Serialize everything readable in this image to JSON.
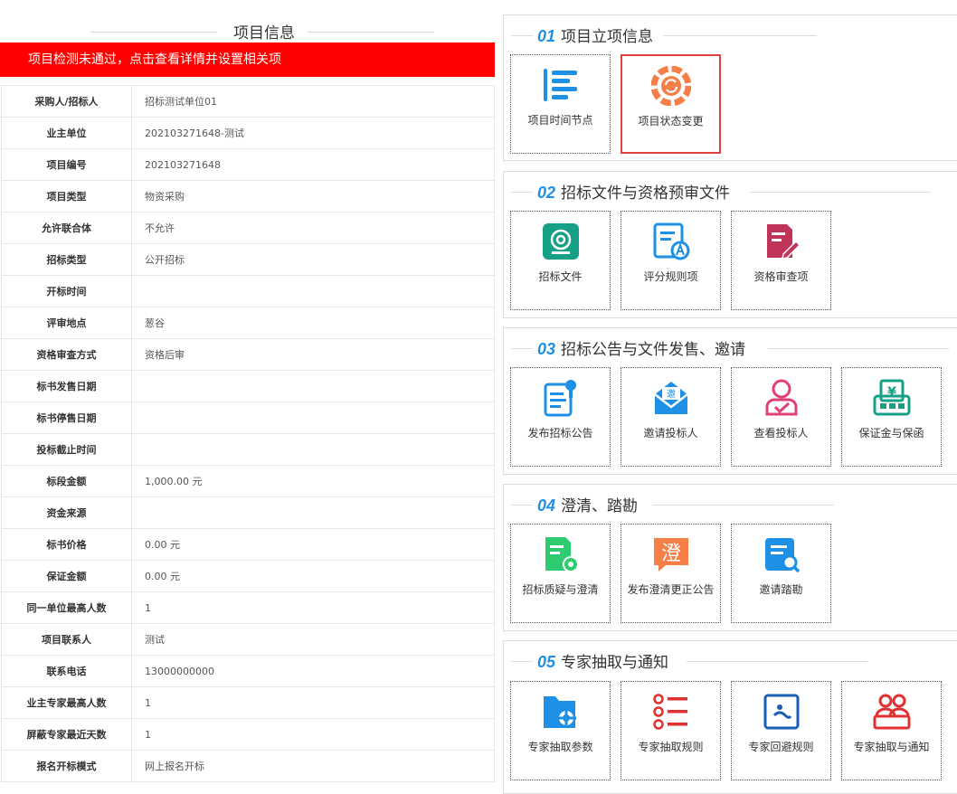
{
  "left": {
    "title": "项目信息",
    "alert": "项目检测未通过，点击查看详情并设置相关项",
    "rows": [
      {
        "key": "采购人/招标人",
        "value": "招标测试单位01"
      },
      {
        "key": "业主单位",
        "value": "202103271648-测试"
      },
      {
        "key": "项目编号",
        "value": "202103271648"
      },
      {
        "key": "项目类型",
        "value": "物资采购"
      },
      {
        "key": "允许联合体",
        "value": "不允许"
      },
      {
        "key": "招标类型",
        "value": "公开招标"
      },
      {
        "key": "开标时间",
        "value": ""
      },
      {
        "key": "评审地点",
        "value": "葱谷"
      },
      {
        "key": "资格审查方式",
        "value": "资格后审"
      },
      {
        "key": "标书发售日期",
        "value": ""
      },
      {
        "key": "标书停售日期",
        "value": ""
      },
      {
        "key": "投标截止时间",
        "value": ""
      },
      {
        "key": "标段金额",
        "value": "1,000.00 元"
      },
      {
        "key": "资金来源",
        "value": ""
      },
      {
        "key": "标书价格",
        "value": "0.00 元"
      },
      {
        "key": "保证金额",
        "value": "0.00 元"
      },
      {
        "key": "同一单位最高人数",
        "value": "1"
      },
      {
        "key": "项目联系人",
        "value": "测试"
      },
      {
        "key": "联系电话",
        "value": "13000000000"
      },
      {
        "key": "业主专家最高人数",
        "value": "1"
      },
      {
        "key": "屏蔽专家最近天数",
        "value": "1"
      },
      {
        "key": "报名开标模式",
        "value": "网上报名开标"
      }
    ]
  },
  "sections": [
    {
      "num": "01",
      "title": "项目立项信息",
      "tiles": [
        {
          "label": "项目时间节点",
          "icon": "timeline-icon",
          "color": "#1e90e6"
        },
        {
          "label": "项目状态变更",
          "icon": "status-change-icon",
          "color": "#f57f46"
        }
      ]
    },
    {
      "num": "02",
      "title": "招标文件与资格预审文件",
      "tiles": [
        {
          "label": "招标文件",
          "icon": "bid-file-icon",
          "color": "#16a085"
        },
        {
          "label": "评分规则项",
          "icon": "scoring-rules-icon",
          "color": "#1e90e6"
        },
        {
          "label": "资格审查项",
          "icon": "qualification-icon",
          "color": "#c0345a"
        }
      ]
    },
    {
      "num": "03",
      "title": "招标公告与文件发售、邀请",
      "tiles": [
        {
          "label": "发布招标公告",
          "icon": "publish-notice-icon",
          "color": "#1e90e6"
        },
        {
          "label": "邀请投标人",
          "icon": "invite-envelope-icon",
          "color": "#1e90e6"
        },
        {
          "label": "查看投标人",
          "icon": "view-bidder-icon",
          "color": "#e0407a"
        },
        {
          "label": "保证金与保函",
          "icon": "deposit-icon",
          "color": "#16a085"
        }
      ]
    },
    {
      "num": "04",
      "title": "澄清、踏勘",
      "tiles": [
        {
          "label": "招标质疑与澄清",
          "icon": "query-clarify-icon",
          "color": "#2ecc71"
        },
        {
          "label": "发布澄清更正公告",
          "icon": "clarify-char-icon",
          "color": "#f57f46",
          "char": "澄"
        },
        {
          "label": "邀请踏勘",
          "icon": "site-inspection-icon",
          "color": "#1e90e6"
        }
      ]
    },
    {
      "num": "05",
      "title": "专家抽取与通知",
      "tiles": [
        {
          "label": "专家抽取参数",
          "icon": "expert-params-icon",
          "color": "#1e90e6"
        },
        {
          "label": "专家抽取规则",
          "icon": "expert-rules-icon",
          "color": "#e03030"
        },
        {
          "label": "专家回避规则",
          "icon": "expert-avoid-icon",
          "color": "#1a5fb4"
        },
        {
          "label": "专家抽取与通知",
          "icon": "expert-notify-icon",
          "color": "#e03030"
        }
      ]
    }
  ]
}
